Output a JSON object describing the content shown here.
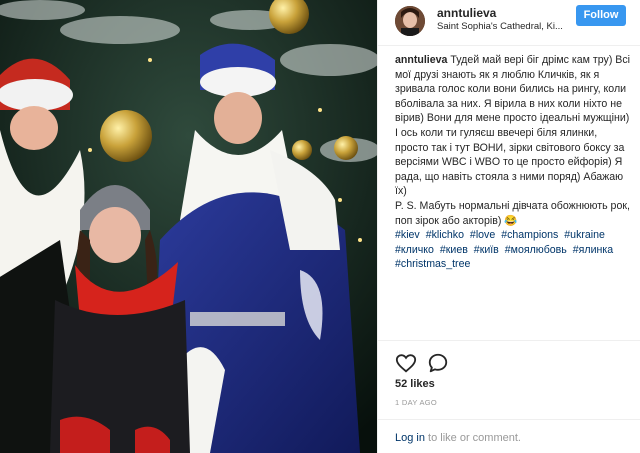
{
  "post": {
    "username": "anntulieva",
    "location": "Saint Sophia's Cathedral, Ki...",
    "follow_label": "Follow",
    "caption_author": "anntulieva",
    "caption_text": " Тудей май вері біг дрімс кам тру) Всі мої друзі знають як я люблю Кличків, як я зривала голос коли вони бились на рингу, коли вболівала за них. Я вірила в них коли ніхто не вірив) Вони для мене просто ідеальні мужщіни) І ось коли ти гуляєш ввечері біля ялинки, просто так і тут ВОНИ, зірки світового боксу за версіями WBC і WBO то це просто ейфорія) Я рада, що навіть стояла з ними поряд) Абажаю їх)\nP. S. Мабуть нормальні дівчата обожнюють рок, поп зірок або акторів) 😂",
    "hashtags": [
      "#kiev",
      "#klichko",
      "#love",
      "#champions",
      "#ukraine",
      "#кличко",
      "#киев",
      "#київ",
      "#моялюбовь",
      "#ялинка",
      "#christmas_tree"
    ],
    "likes": "52 likes",
    "timestamp": "1 DAY AGO"
  },
  "footer": {
    "login_link": "Log in",
    "login_suffix": " to like or comment."
  },
  "icons": {
    "like": "heart-outline-icon",
    "comment": "speech-bubble-icon"
  },
  "colors": {
    "follow_button": "#3897f0",
    "hashtag": "#003569",
    "muted": "#999999",
    "border": "#efefef"
  }
}
